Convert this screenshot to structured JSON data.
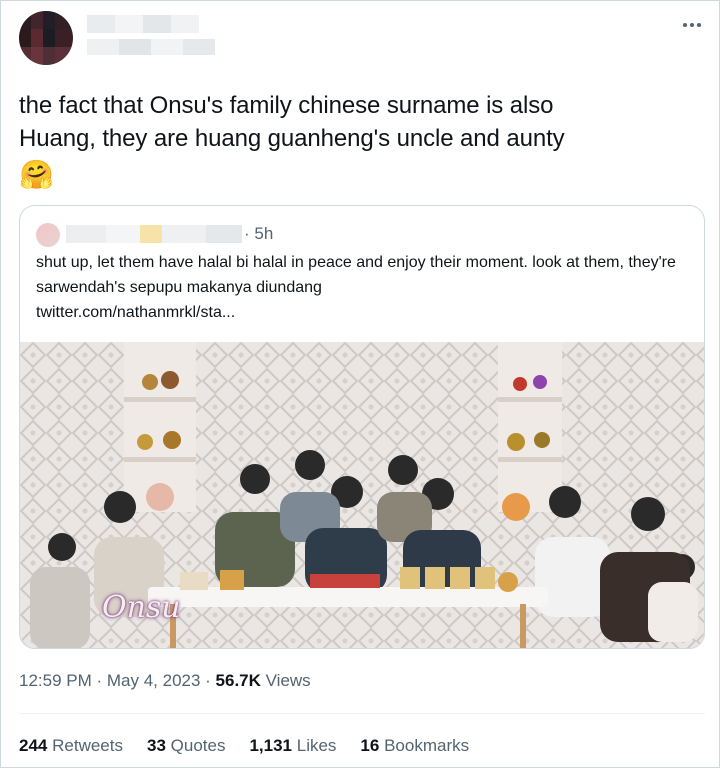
{
  "tweet": {
    "text_line1": "the fact that Onsu's family chinese surname is also",
    "text_line2": "Huang, they are huang guanheng's uncle and aunty",
    "emoji": "🤗"
  },
  "quoted": {
    "time": "· 5h",
    "text": "shut up, let them have halal bi halal in peace and enjoy their moment. look at them, they're sarwendah's sepupu makanya diundang",
    "link": "twitter.com/nathanmrkl/sta...",
    "media": {
      "watermark": "Onsu"
    }
  },
  "meta": {
    "time": "12:59 PM",
    "separator": " · ",
    "date": "May 4, 2023",
    "views_count": "56.7K",
    "views_label": " Views"
  },
  "stats": {
    "retweets": {
      "count": "244",
      "label": "Retweets"
    },
    "quotes": {
      "count": "33",
      "label": "Quotes"
    },
    "likes": {
      "count": "1,131",
      "label": "Likes"
    },
    "bookmarks": {
      "count": "16",
      "label": "Bookmarks"
    }
  },
  "icons": {
    "more": "more-horizontal-icon",
    "emoji": "hugging-face-emoji"
  },
  "colors": {
    "secondary_text": "#536471",
    "primary_text": "#0f1419",
    "border": "#cfd9de"
  }
}
